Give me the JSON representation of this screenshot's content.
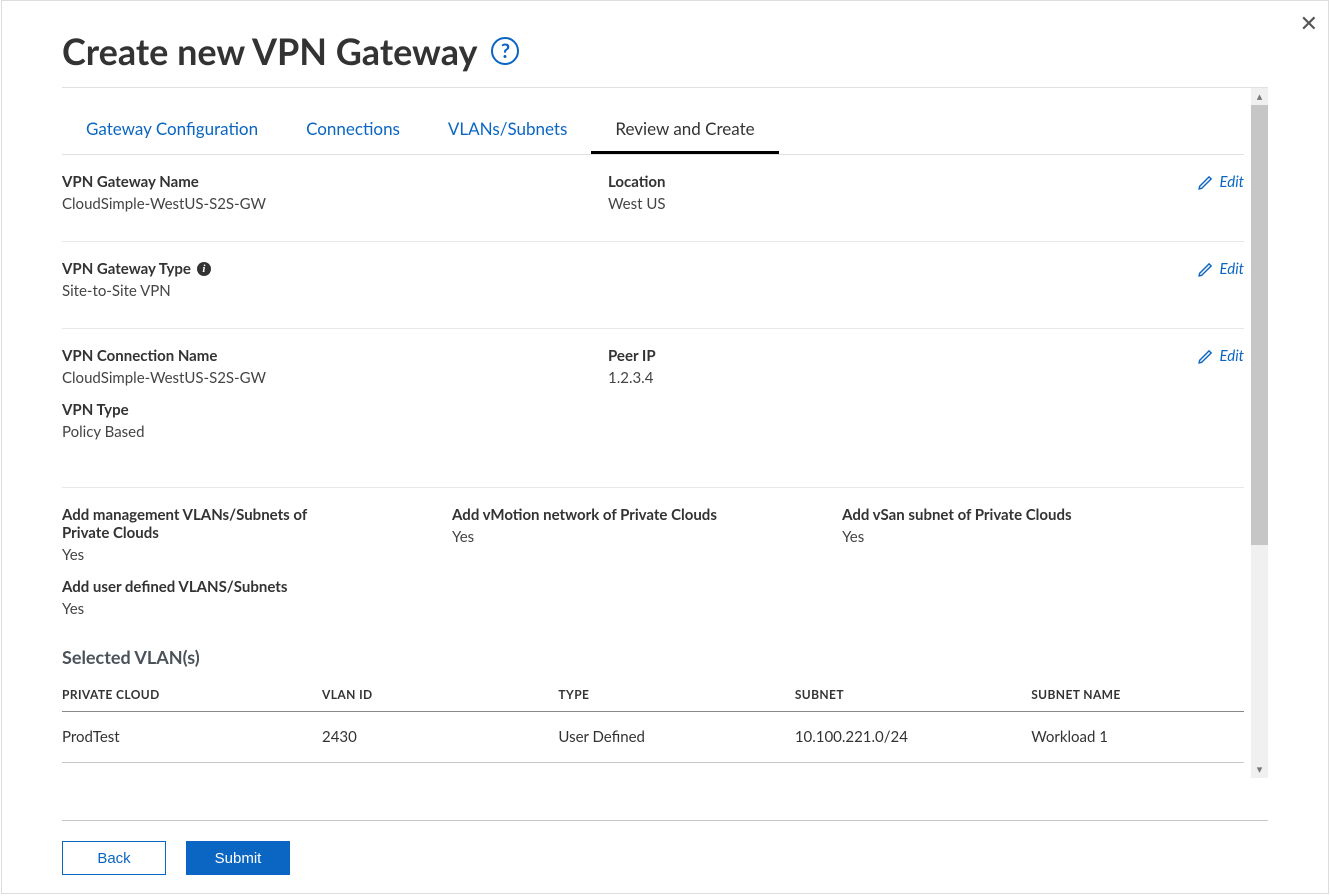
{
  "title": "Create new VPN Gateway",
  "close_icon_glyph": "✕",
  "tabs": [
    {
      "label": "Gateway Configuration"
    },
    {
      "label": "Connections"
    },
    {
      "label": "VLANs/Subnets"
    },
    {
      "label": "Review and Create"
    }
  ],
  "active_tab_index": 3,
  "edit_label": "Edit",
  "sections": {
    "gateway": {
      "name_label": "VPN Gateway Name",
      "name_value": "CloudSimple-WestUS-S2S-GW",
      "location_label": "Location",
      "location_value": "West US"
    },
    "gateway_type": {
      "label": "VPN Gateway Type",
      "value": "Site-to-Site VPN"
    },
    "connection": {
      "name_label": "VPN Connection Name",
      "name_value": "CloudSimple-WestUS-S2S-GW",
      "peer_label": "Peer IP",
      "peer_value": "1.2.3.4",
      "type_label": "VPN Type",
      "type_value": "Policy Based"
    },
    "vlan_opts": {
      "mgmt_label": "Add management VLANs/Subnets of Private Clouds",
      "mgmt_value": "Yes",
      "vmotion_label": "Add vMotion network of Private Clouds",
      "vmotion_value": "Yes",
      "vsan_label": "Add vSan subnet of Private Clouds",
      "vsan_value": "Yes",
      "user_label": "Add user defined VLANS/Subnets",
      "user_value": "Yes"
    }
  },
  "vlan_table": {
    "heading": "Selected VLAN(s)",
    "columns": [
      "PRIVATE CLOUD",
      "VLAN ID",
      "TYPE",
      "SUBNET",
      "SUBNET NAME"
    ],
    "rows": [
      {
        "private_cloud": "ProdTest",
        "vlan_id": "2430",
        "type": "User Defined",
        "subnet": "10.100.221.0/24",
        "subnet_name": "Workload 1"
      }
    ]
  },
  "footer": {
    "back": "Back",
    "submit": "Submit"
  }
}
